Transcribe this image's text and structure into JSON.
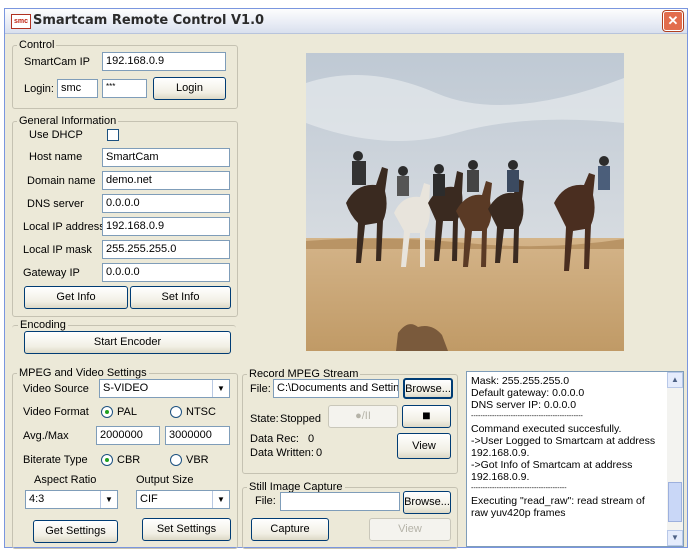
{
  "window": {
    "title": "Smartcam Remote Control V1.0",
    "icon_text": "smc",
    "close_icon": "close-icon"
  },
  "control": {
    "legend": "Control",
    "smartcam_ip_label": "SmartCam IP",
    "smartcam_ip": "192.168.0.9",
    "login_label": "Login:",
    "username": "smc",
    "password": "***",
    "login_button": "Login"
  },
  "general": {
    "legend": "General Information",
    "use_dhcp_label": "Use DHCP",
    "use_dhcp_checked": false,
    "host_name_label": "Host name",
    "host_name": "SmartCam",
    "domain_name_label": "Domain name",
    "domain_name": "demo.net",
    "dns_server_label": "DNS server",
    "dns_server": "0.0.0.0",
    "local_ip_label": "Local IP address",
    "local_ip": "192.168.0.9",
    "local_mask_label": "Local IP mask",
    "local_mask": "255.255.255.0",
    "gateway_label": "Gateway IP",
    "gateway": "0.0.0.0",
    "get_info_button": "Get Info",
    "set_info_button": "Set Info"
  },
  "encoding": {
    "legend": "Encoding",
    "start_encoder_button": "Start Encoder"
  },
  "mpeg": {
    "legend": "MPEG and Video Settings",
    "video_source_label": "Video Source",
    "video_source": "S-VIDEO",
    "video_format_label": "Video Format",
    "format_pal": "PAL",
    "format_ntsc": "NTSC",
    "format_selected": "PAL",
    "avg_max_label": "Avg./Max",
    "avg": "2000000",
    "max": "3000000",
    "bitrate_label": "Biterate Type",
    "bitrate_cbr": "CBR",
    "bitrate_vbr": "VBR",
    "bitrate_selected": "CBR",
    "aspect_ratio_label": "Aspect Ratio",
    "aspect_ratio": "4:3",
    "output_size_label": "Output Size",
    "output_size": "CIF",
    "get_settings_button": "Get Settings",
    "set_settings_button": "Set Settings"
  },
  "record": {
    "legend": "Record MPEG Stream",
    "file_label": "File:",
    "file": "C:\\Documents and Settings",
    "browse_button": "Browse...",
    "state_label": "State:",
    "state": "Stopped",
    "play_pause_glyph": "●/II",
    "stop_glyph": "■",
    "data_rec_label": "Data Rec:",
    "data_rec": "0",
    "data_written_label": "Data Written:",
    "data_written": "0",
    "view_button": "View"
  },
  "still": {
    "legend": "Still Image Capture",
    "file_label": "File:",
    "file": "",
    "browse_button": "Browse...",
    "capture_button": "Capture",
    "view_button": "View"
  },
  "log": {
    "lines": [
      "Mask: 255.255.255.0",
      "Default gateway: 0.0.0.0",
      "DNS server IP: 0.0.0.0",
      "------------------------------------------------",
      "Command executed succesfully.",
      "->User Logged to Smartcam at address 192.168.0.9.",
      "->Got Info of Smartcam at address 192.168.0.9.",
      "-----------------------------------------",
      "Executing \"read_raw\": read stream of raw yuv420p frames"
    ]
  },
  "colors": {
    "accent_radio": "#21a121",
    "border": "#7f9db9",
    "window_bg": "#ece9d8",
    "video_sky": "#c9d3dc",
    "video_sand": "#c9a472"
  }
}
